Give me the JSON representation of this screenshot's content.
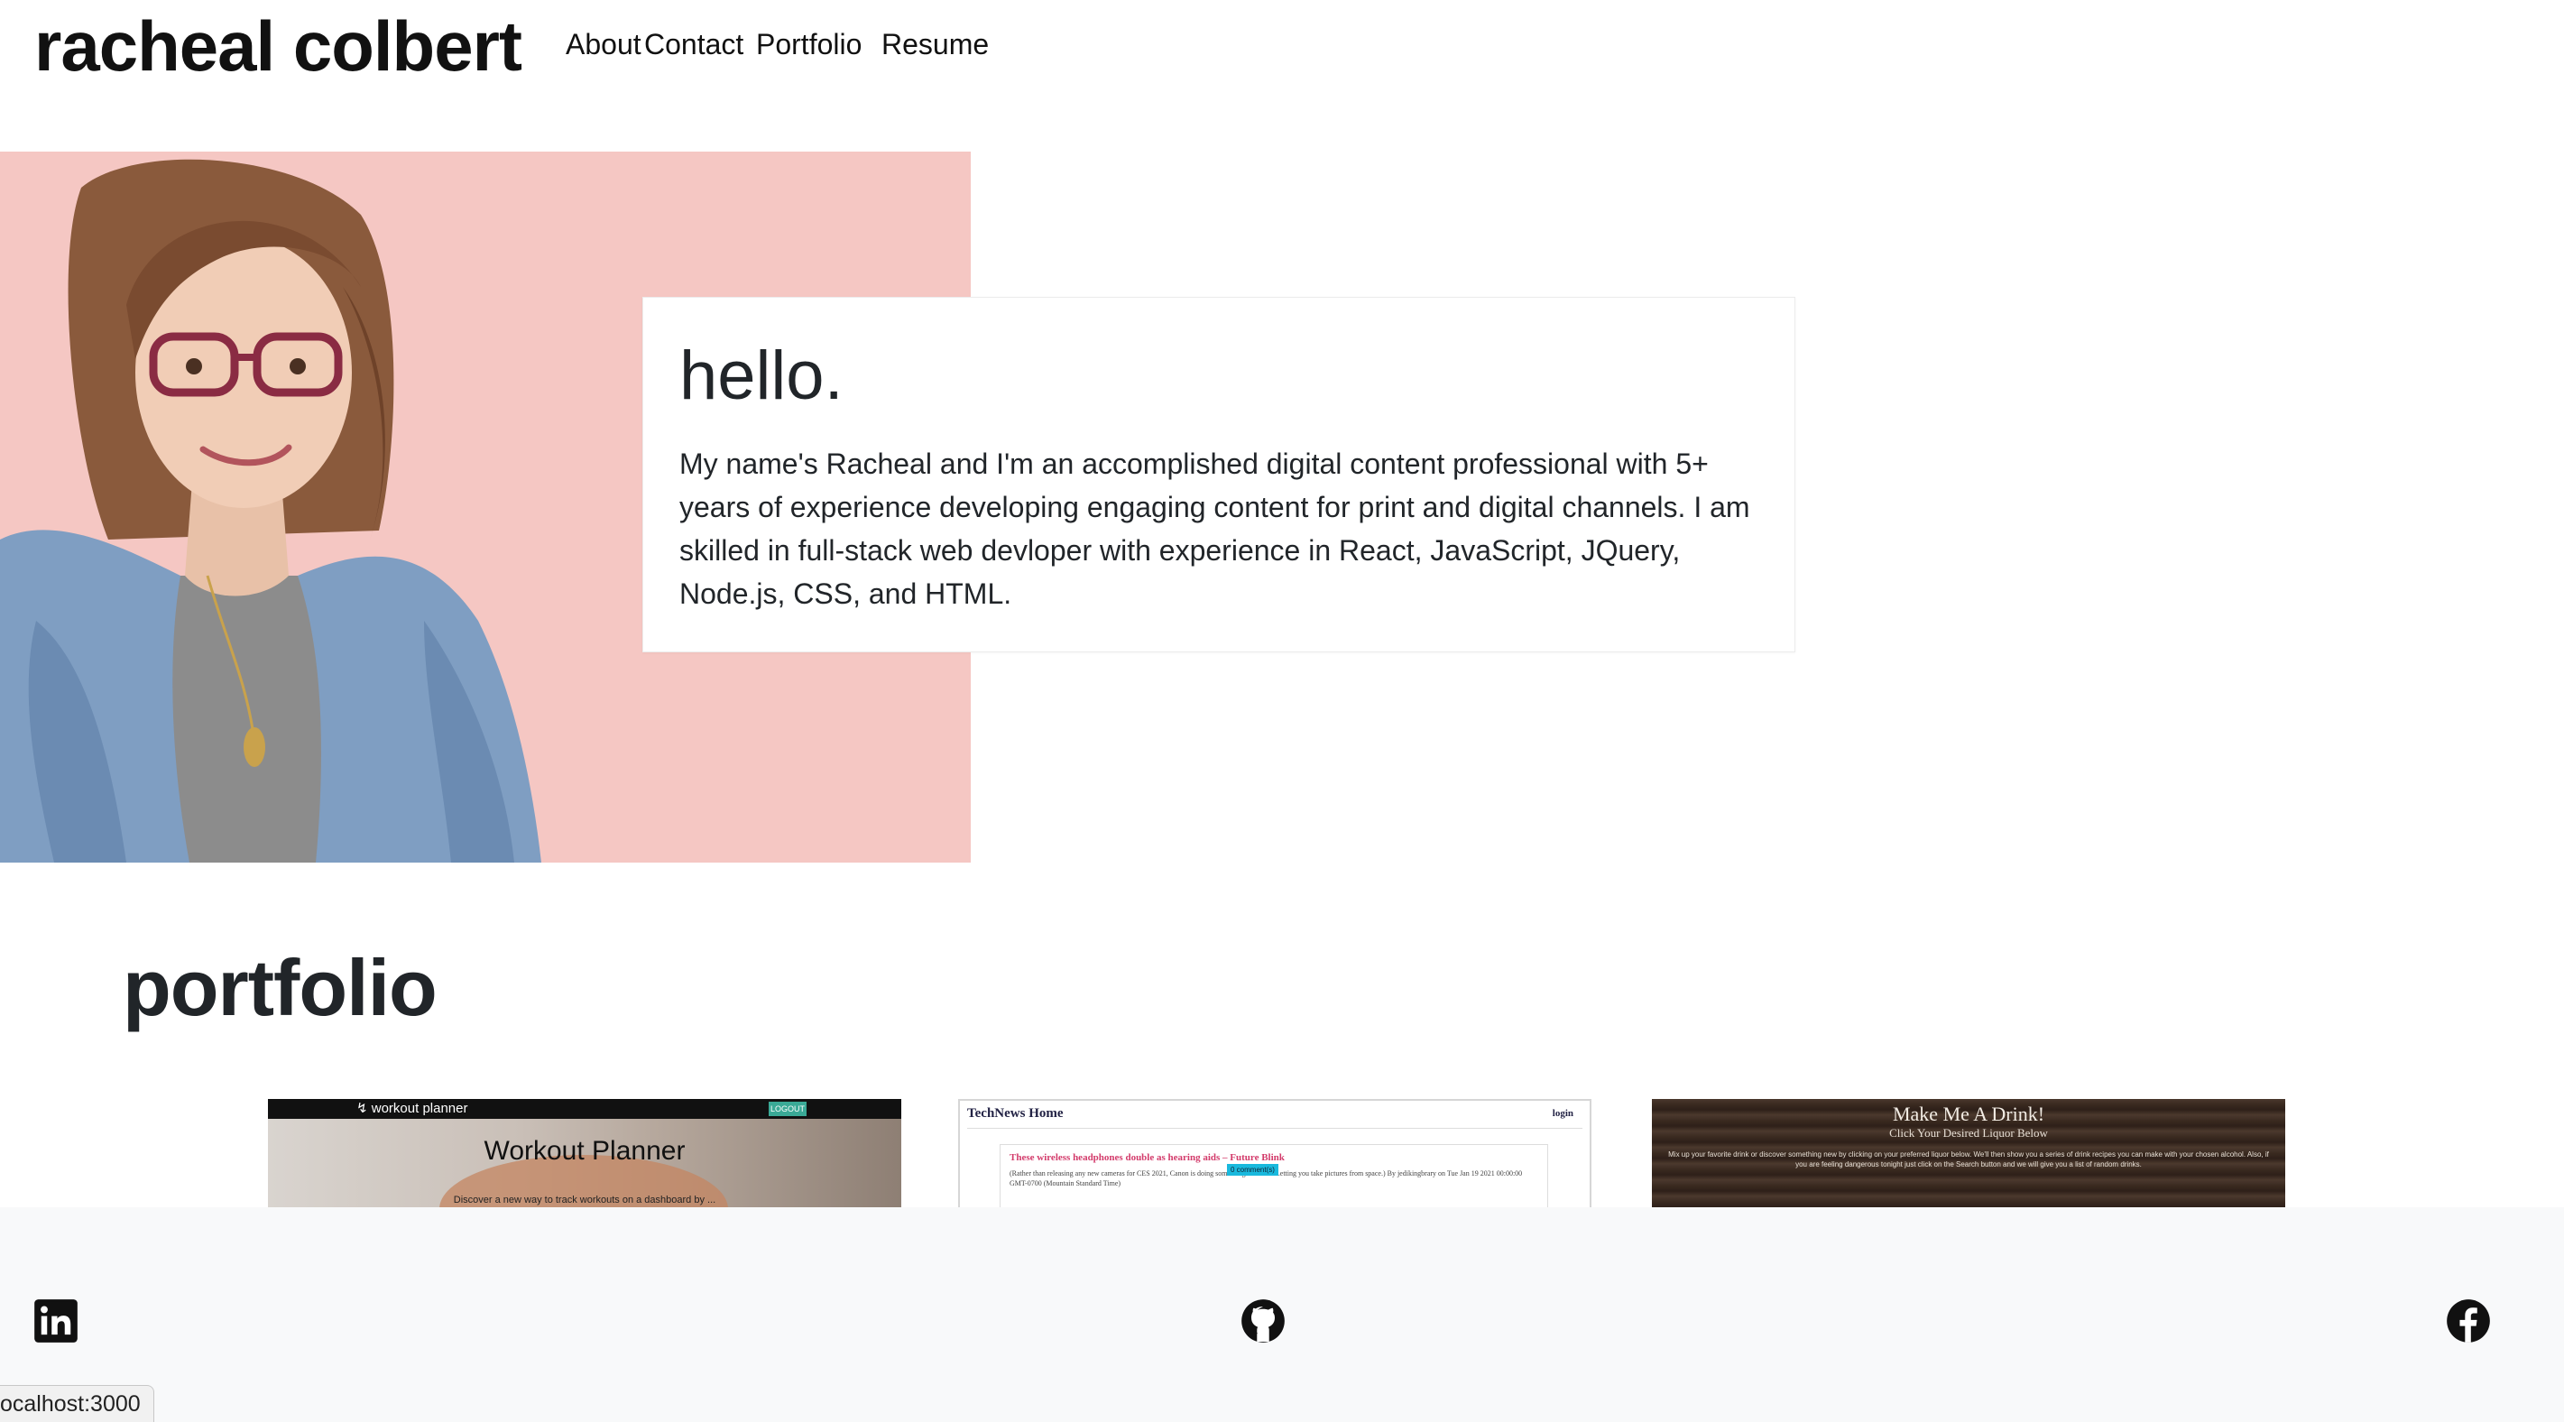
{
  "header": {
    "brand": "racheal colbert",
    "nav": [
      "About",
      "Contact",
      "Portfolio",
      "Resume"
    ]
  },
  "hero": {
    "title": "hello.",
    "text": "My name's Racheal and I'm an accomplished digital content professional with 5+ years of experience developing engaging content for print and digital channels. I am skilled in full-stack web devloper with experience in React, JavaScript, JQuery, Node.js, CSS, and HTML.",
    "bg_color": "#f5c7c3"
  },
  "portfolio": {
    "title": "portfolio",
    "projects": [
      {
        "logo": "workout planner",
        "badge": "LOGOUT",
        "title": "Workout Planner",
        "subtitle": "Discover a new way to track workouts on a dashboard by ..."
      },
      {
        "title": "TechNews Home",
        "login": "login",
        "post_title": "These wireless headphones double as hearing aids – Future Blink",
        "post_text": "(Rather than releasing any new cameras for CES 2021, Canon is doing something different. Letting you take pictures from space.) By jedikingbrary on Tue Jan 19 2021 00:00:00 GMT-0700 (Mountain Standard Time)",
        "comment_label": "0 comment(s)"
      },
      {
        "title": "Make Me A Drink!",
        "subtitle": "Click Your Desired Liquor Below",
        "text": "Mix up your favorite drink or discover something new by clicking on your preferred liquor below. We'll then show you a series of drink recipes you can make with your chosen alcohol. Also, if you are feeling dangerous tonight just click on the Search button and we will give you a list of random drinks."
      }
    ]
  },
  "footer": {
    "icons": [
      "linkedin-icon",
      "github-icon",
      "facebook-icon"
    ]
  },
  "status_bar": {
    "url": "ocalhost:3000"
  }
}
